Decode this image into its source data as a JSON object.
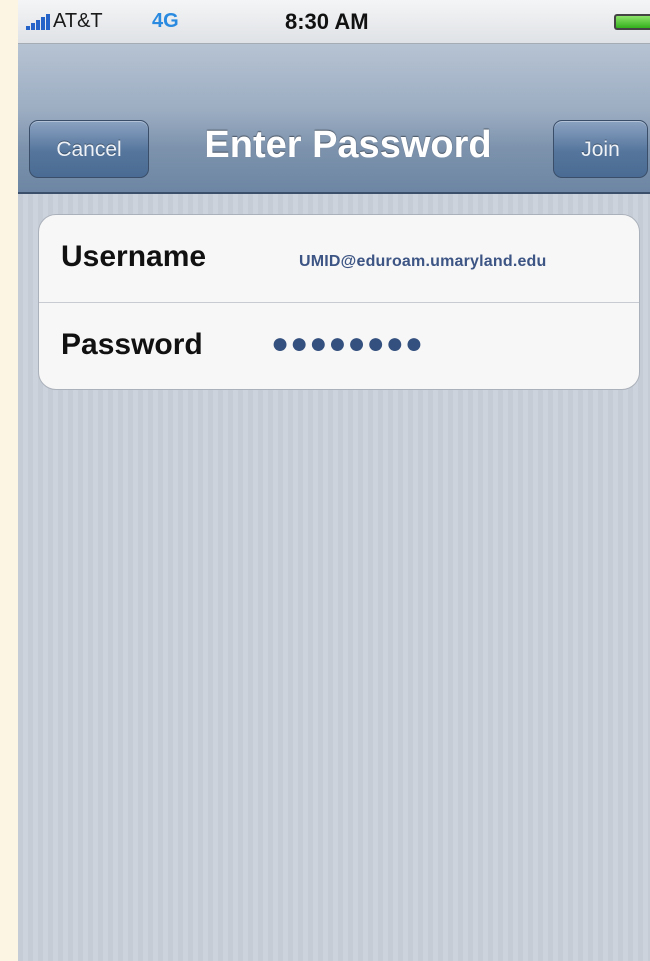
{
  "status_bar": {
    "carrier": "AT&T",
    "network": "4G",
    "time": "8:30 AM",
    "signal_bars": 5
  },
  "nav": {
    "title": "Enter Password",
    "cancel_label": "Cancel",
    "join_label": "Join"
  },
  "form": {
    "username_label": "Username",
    "username_value": "UMID@eduroam.umaryland.edu",
    "password_label": "Password",
    "password_value": "●●●●●●●●"
  },
  "colors": {
    "network_text": "#2a8ae0",
    "value_text": "#3d5584",
    "battery_fill": "#33b11c"
  }
}
